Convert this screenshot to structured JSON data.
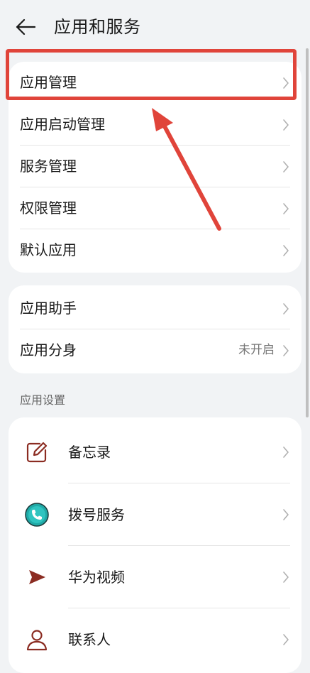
{
  "header": {
    "title": "应用和服务"
  },
  "group1": {
    "items": [
      {
        "label": "应用管理"
      },
      {
        "label": "应用启动管理"
      },
      {
        "label": "服务管理"
      },
      {
        "label": "权限管理"
      },
      {
        "label": "默认应用"
      }
    ]
  },
  "group2": {
    "items": [
      {
        "label": "应用助手"
      },
      {
        "label": "应用分身",
        "value": "未开启"
      }
    ]
  },
  "section": {
    "title": "应用设置"
  },
  "apps": {
    "items": [
      {
        "label": "备忘录",
        "icon": "notepad-icon"
      },
      {
        "label": "拨号服务",
        "icon": "phone-icon"
      },
      {
        "label": "华为视频",
        "icon": "video-play-icon"
      },
      {
        "label": "联系人",
        "icon": "contact-person-icon"
      }
    ]
  },
  "colors": {
    "annotation_red": "#e0443a",
    "app_icon_brown": "#8b2c22",
    "phone_teal": "#1fa9a6",
    "background": "#f1f3f5",
    "card": "#ffffff"
  }
}
